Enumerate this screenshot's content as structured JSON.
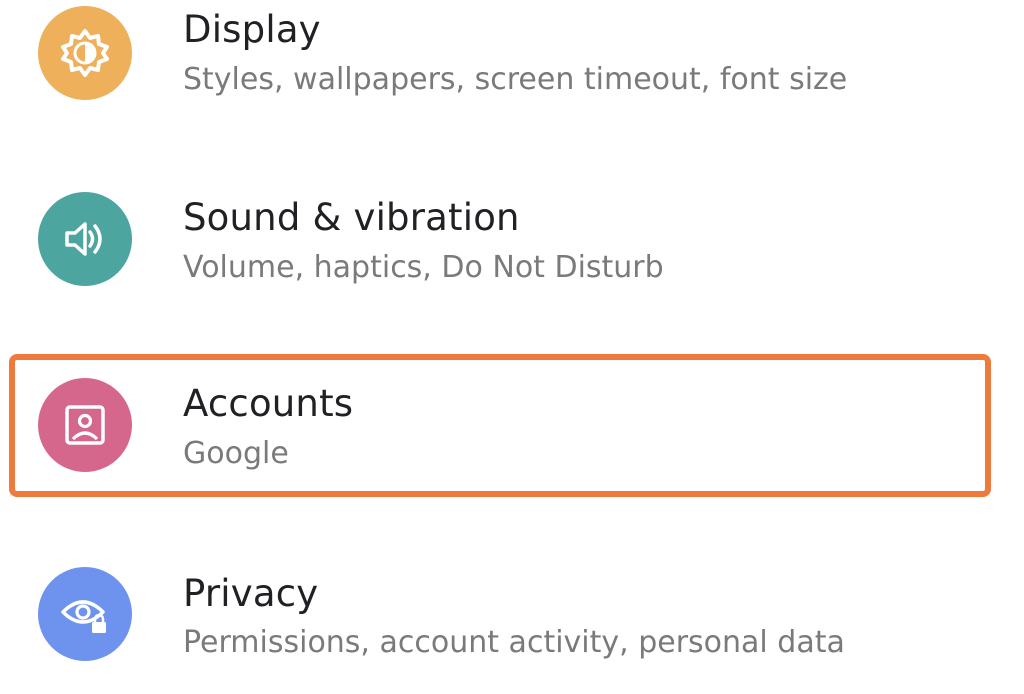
{
  "settings": {
    "items": [
      {
        "title": "Display",
        "subtitle": "Styles, wallpapers, screen timeout, font size",
        "icon": "brightness-icon",
        "color": "#EEB05A"
      },
      {
        "title": "Sound & vibration",
        "subtitle": "Volume, haptics, Do Not Disturb",
        "icon": "volume-icon",
        "color": "#4DA5A0"
      },
      {
        "title": "Accounts",
        "subtitle": "Google",
        "icon": "account-box-icon",
        "color": "#D6678C"
      },
      {
        "title": "Privacy",
        "subtitle": "Permissions, account activity, personal data",
        "icon": "privacy-eye-lock-icon",
        "color": "#6E93EE"
      }
    ]
  },
  "highlight": {
    "target": "Accounts",
    "color": "#EF7A3D"
  }
}
